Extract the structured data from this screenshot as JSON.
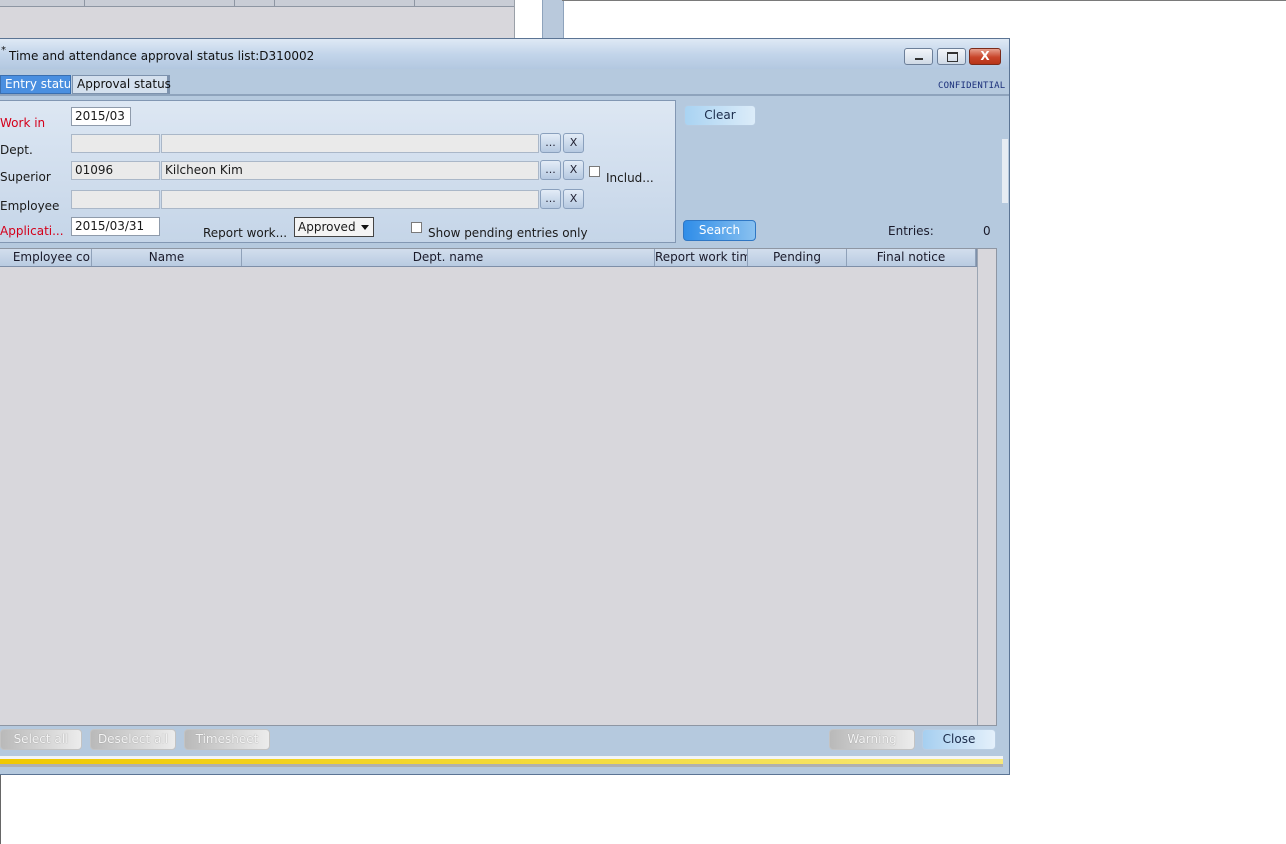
{
  "window": {
    "title": "Time and attendance approval status list:D310002",
    "title_marker": "*",
    "close_glyph": "X",
    "confidential": "CONFIDENTIAL"
  },
  "tabs": [
    {
      "label": "Entry status",
      "active": true
    },
    {
      "label": "Approval status",
      "active": false
    }
  ],
  "filters": {
    "work_in": {
      "label": "Work in",
      "value": "2015/03"
    },
    "dept": {
      "label": "Dept.",
      "code": "",
      "name": ""
    },
    "superior": {
      "label": "Superior",
      "code": "01096",
      "name": "Kilcheon Kim",
      "include_label": "Includ...",
      "include_checked": false
    },
    "employee": {
      "label": "Employee",
      "code": "",
      "name": ""
    },
    "application": {
      "label": "Applicati...",
      "value": "2015/03/31"
    },
    "report_work": {
      "label": "Report work...",
      "selected": "Approved"
    },
    "pending_only": {
      "label": "Show pending entries only",
      "checked": false
    }
  },
  "lookup_button_label": "...",
  "clear_field_label": "X",
  "buttons": {
    "clear": "Clear",
    "search": "Search",
    "select_all": "Select all",
    "deselect_all": "Deselect all",
    "timesheet": "Timesheet",
    "warning": "Warning",
    "close": "Close"
  },
  "entries": {
    "label": "Entries:",
    "count": "0"
  },
  "grid": {
    "columns": [
      "Employee co",
      "Name",
      "Dept. name",
      "Report work tim",
      "Pending",
      "Final notice"
    ],
    "rows": []
  },
  "colors": {
    "window_bg": "#b5c9de",
    "active_tab": "#4a8fe0",
    "required_label": "#d4001a",
    "grid_bg": "#d8d7dc",
    "stripe": "#f0c800"
  }
}
